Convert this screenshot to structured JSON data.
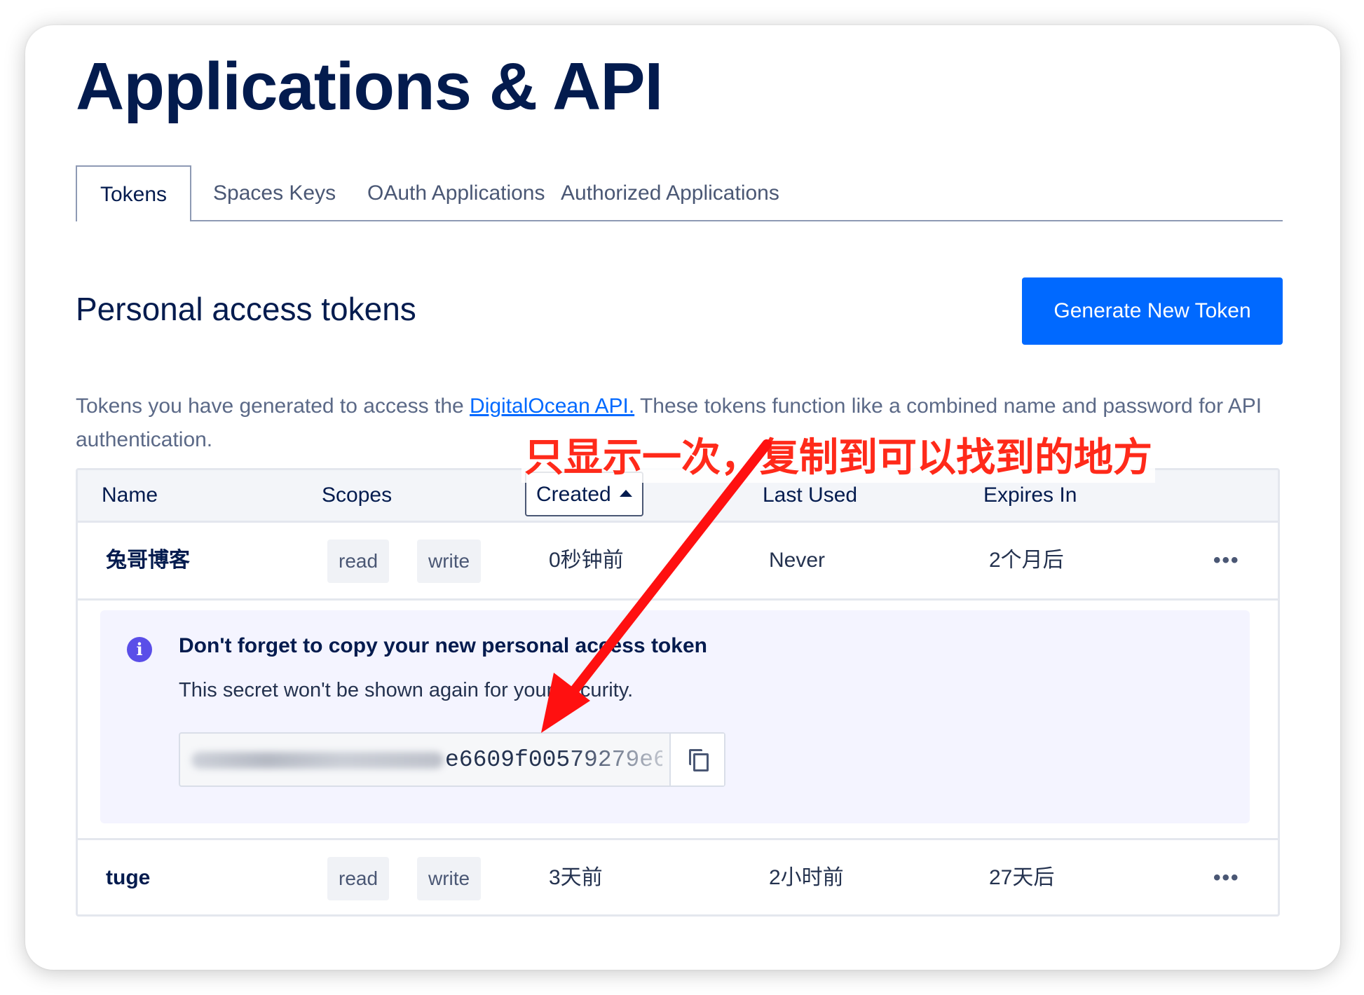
{
  "page": {
    "title": "Applications & API"
  },
  "tabs": [
    {
      "label": "Tokens",
      "active": true
    },
    {
      "label": "Spaces Keys",
      "active": false
    },
    {
      "label": "OAuth Applications",
      "active": false
    },
    {
      "label": "Authorized Applications",
      "active": false
    }
  ],
  "section": {
    "title": "Personal access tokens",
    "generate_button": "Generate New Token",
    "desc_before": "Tokens you have generated to access the ",
    "desc_link": "DigitalOcean API.",
    "desc_after": " These tokens function like a combined name and password for API authentication."
  },
  "table": {
    "headers": {
      "name": "Name",
      "scopes": "Scopes",
      "created": "Created",
      "last_used": "Last Used",
      "expires_in": "Expires In"
    },
    "rows": [
      {
        "name": "兔哥博客",
        "scope1": "read",
        "scope2": "write",
        "created": "0秒钟前",
        "last_used": "Never",
        "expires_in": "2个月后",
        "menu": "•••"
      },
      {
        "name": "tuge",
        "scope1": "read",
        "scope2": "write",
        "created": "3天前",
        "last_used": "2小时前",
        "expires_in": "27天后",
        "menu": "•••"
      }
    ]
  },
  "notice": {
    "icon_text": "i",
    "title": "Don't forget to copy your new personal access token",
    "subtitle": "This secret won't be shown again for your security.",
    "token_visible": "e6609f00579279e6"
  },
  "annotation": {
    "text": "只显示一次，复制到可以找到的地方",
    "color": "#ff2a1a"
  },
  "colors": {
    "brand_blue": "#0069ff",
    "title_navy": "#031b4e",
    "info_purple": "#5a4ee8",
    "annotation_red": "#ff2a1a"
  },
  "icons": [
    "info-icon",
    "copy-icon",
    "more-options-icon",
    "sort-ascending-icon",
    "annotation-arrow"
  ]
}
